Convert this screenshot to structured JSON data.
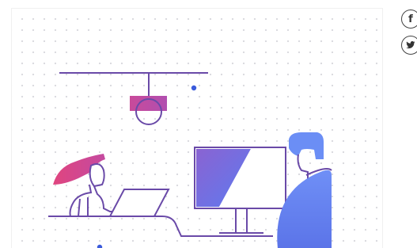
{
  "hero": {
    "illustration": "person-at-laptop-and-person-at-monitor-illustration"
  },
  "share": {
    "items": [
      {
        "icon": "facebook-icon",
        "glyph": "f"
      },
      {
        "icon": "twitter-icon",
        "glyph": ""
      }
    ]
  },
  "colors": {
    "line": "#6a4aa8",
    "accent_pink": "#d64c8f",
    "accent_blue": "#3b5bdb",
    "person_blue": "#6b8ef5",
    "monitor_gradient_start": "#8e6bd8",
    "monitor_gradient_end": "#5f7cf0"
  }
}
